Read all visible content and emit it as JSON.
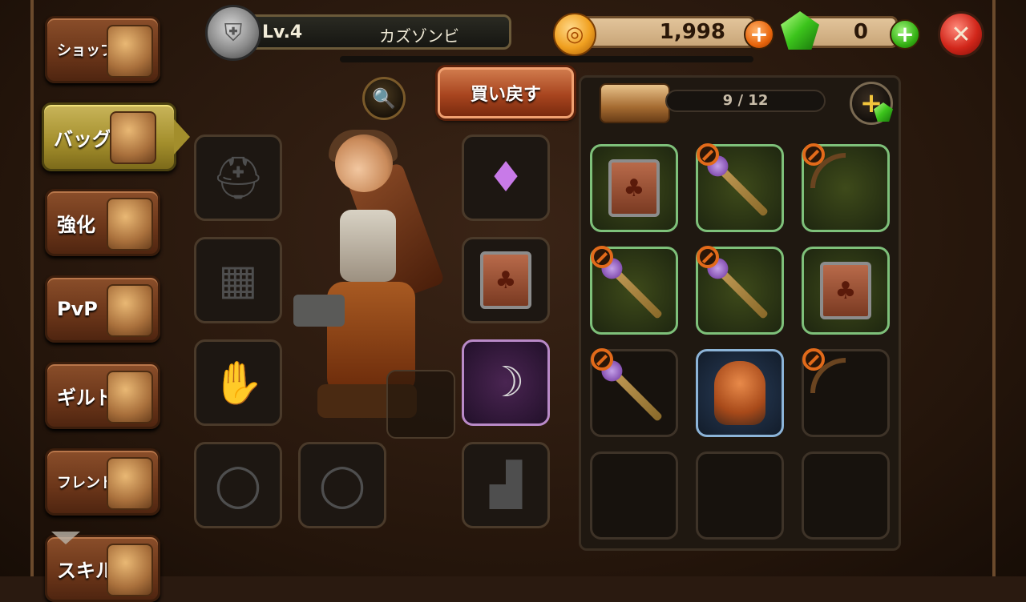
{
  "nav": {
    "items": [
      {
        "label": "ショップ",
        "icon": "treasure-chest-icon"
      },
      {
        "label": "バッグ",
        "icon": "backpack-icon",
        "active": true
      },
      {
        "label": "強化",
        "icon": "hammer-icon"
      },
      {
        "label": "PvP",
        "icon": "sword-pouch-icon"
      },
      {
        "label": "ギルド",
        "icon": "guild-banner-icon"
      },
      {
        "label": "フレンド",
        "icon": "friend-orb-icon"
      },
      {
        "label": "スキル",
        "icon": "skill-scroll-icon"
      }
    ]
  },
  "header": {
    "level": "Lv.4",
    "player_name": "カズゾンビ",
    "gold": "1,998",
    "gems": "0"
  },
  "actions": {
    "buyback_label": "買い戻す"
  },
  "inventory": {
    "capacity": "9 / 12",
    "slots": [
      {
        "item": "shield",
        "frame": "green",
        "restricted": false
      },
      {
        "item": "staff",
        "frame": "green",
        "restricted": true
      },
      {
        "item": "bow",
        "frame": "green",
        "restricted": true
      },
      {
        "item": "staff",
        "frame": "green",
        "restricted": true
      },
      {
        "item": "staff",
        "frame": "green",
        "restricted": true
      },
      {
        "item": "shield",
        "frame": "green",
        "restricted": false
      },
      {
        "item": "staff",
        "frame": "dark",
        "restricted": true
      },
      {
        "item": "goblin-pet",
        "frame": "blue",
        "restricted": false
      },
      {
        "item": "bow",
        "frame": "dark",
        "restricted": true
      },
      {
        "item": "empty",
        "frame": "dark",
        "restricted": false
      },
      {
        "item": "empty",
        "frame": "dark",
        "restricted": false
      },
      {
        "item": "empty",
        "frame": "dark",
        "restricted": false
      }
    ]
  },
  "equipment": {
    "slots": [
      "helmet",
      "amulet",
      "armor",
      "shield",
      "gloves",
      "weapon",
      "ring",
      "ring",
      "boots"
    ]
  },
  "colors": {
    "accent_gold": "#c9b55a",
    "button_brown": "#8a4e2a",
    "restricted_orange": "#e26a1a",
    "rare_purple": "#b98ac8"
  }
}
